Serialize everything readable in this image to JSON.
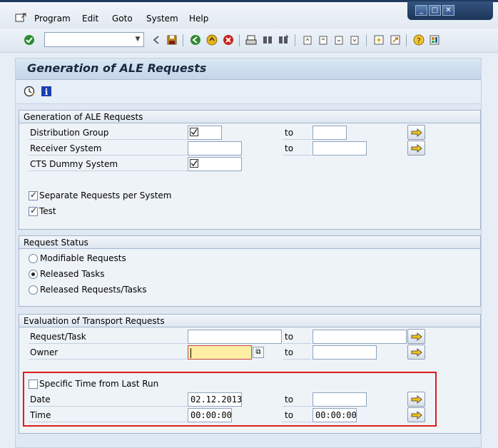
{
  "menu": {
    "program": "Program",
    "edit": "Edit",
    "goto": "Goto",
    "system": "System",
    "help": "Help"
  },
  "command_field": {
    "value": ""
  },
  "page": {
    "title": "Generation of ALE Requests"
  },
  "group_ale": {
    "title": "Generation of ALE Requests",
    "distribution_group": "Distribution Group",
    "receiver_system": "Receiver System",
    "cts_dummy_system": "CTS Dummy System",
    "to": "to",
    "separate_requests": "Separate Requests per System",
    "test": "Test"
  },
  "group_status": {
    "title": "Request Status",
    "modifiable": "Modifiable Requests",
    "released_tasks": "Released Tasks",
    "released_requests_tasks": "Released Requests/Tasks"
  },
  "group_eval": {
    "title": "Evaluation of Transport Requests",
    "request_task": "Request/Task",
    "owner": "Owner",
    "to": "to",
    "specific_time": "Specific Time from Last Run",
    "date": "Date",
    "time": "Time",
    "date_from": "02.12.2013",
    "date_to": "",
    "time_from": "00:00:00",
    "time_to": "00:00:00"
  },
  "icons": {
    "enter": "check-icon",
    "save": "save-icon",
    "back": "back-icon",
    "exit": "exit-icon",
    "cancel": "cancel-icon",
    "execute": "execute-icon",
    "info": "info-icon",
    "multiple_selection": "arrow-right-icon"
  },
  "colors": {
    "required_field": "#fdeea4",
    "highlight_border": "#e01c1c",
    "window_bar": "#1f3a60"
  }
}
